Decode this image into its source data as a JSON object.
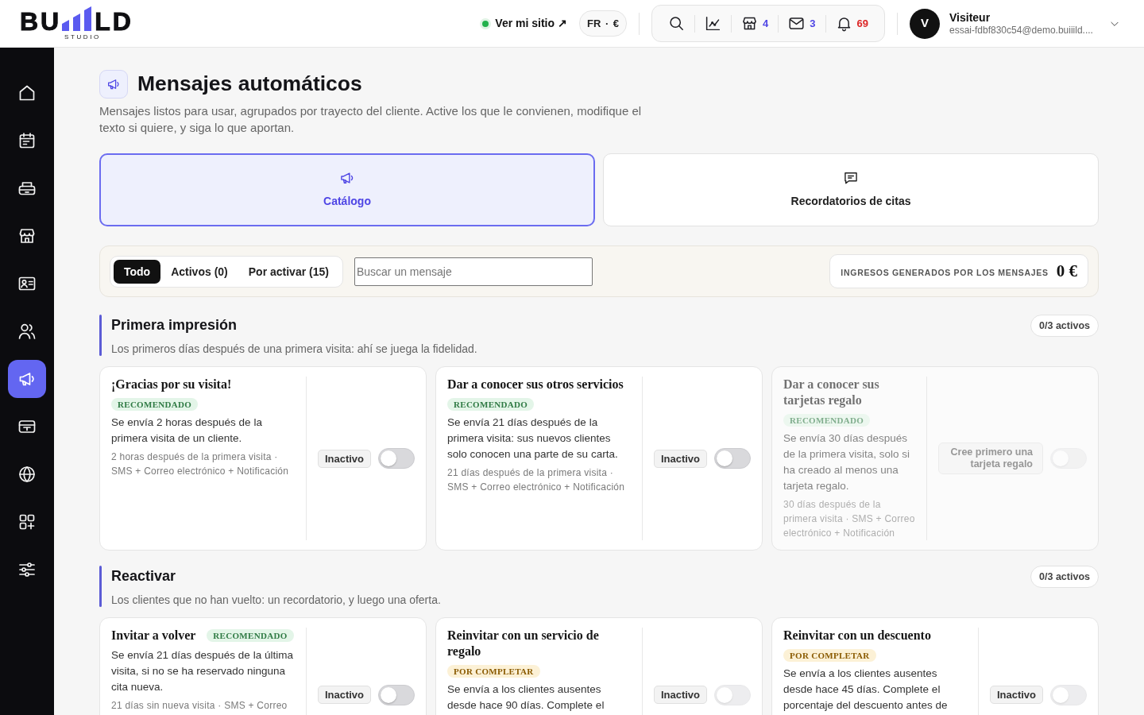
{
  "header": {
    "logo": {
      "left": "BU",
      "right": "LD",
      "tagline": "STUDIO"
    },
    "site_link": {
      "label": "Ver mi sitio ↗",
      "live": true
    },
    "locale": {
      "label": "FR · €"
    },
    "toolbar": [
      {
        "kind": "search"
      },
      {
        "kind": "chart"
      },
      {
        "kind": "store",
        "count": "4",
        "color": "#4f46e5"
      },
      {
        "kind": "mail",
        "count": "3",
        "color": "#4f46e5"
      },
      {
        "kind": "bell",
        "count": "69",
        "color": "#dc2626"
      }
    ],
    "user": {
      "initial": "V",
      "name": "Visiteur",
      "email": "essai-fdbf830c54@demo.buiiild...."
    }
  },
  "sidebar": {
    "items": [
      {
        "kind": "home",
        "selected": false
      },
      {
        "kind": "calendar",
        "selected": false
      },
      {
        "kind": "printer",
        "selected": false
      },
      {
        "kind": "store",
        "selected": false
      },
      {
        "kind": "contact",
        "selected": false
      },
      {
        "kind": "users",
        "selected": false
      },
      {
        "kind": "megaphone",
        "selected": true
      },
      {
        "kind": "card",
        "selected": false
      },
      {
        "kind": "globe",
        "selected": false
      },
      {
        "kind": "apps",
        "selected": false
      },
      {
        "kind": "sliders",
        "selected": false
      }
    ]
  },
  "page": {
    "title": "Mensajes automáticos",
    "description": "Mensajes listos para usar, agrupados por trayecto del cliente. Active los que le convienen, modifique el texto si quiere, y siga lo que aportan."
  },
  "category_tabs": [
    {
      "kind": "megaphone",
      "label": "Catálogo",
      "selected": true
    },
    {
      "kind": "chat",
      "label": "Recordatorios de citas",
      "selected": false
    }
  ],
  "filters": [
    {
      "label": "Todo",
      "selected": true
    },
    {
      "label": "Activos (0)",
      "selected": false
    },
    {
      "label": "Por activar (15)",
      "selected": false
    }
  ],
  "search": {
    "placeholder": "Buscar un mensaje"
  },
  "revenue": {
    "label": "INGRESOS GENERADOS POR LOS MENSAJES",
    "value": "0 €"
  },
  "sections": [
    {
      "title": "Primera impresión",
      "subtitle": "Los primeros días después de una primera visita: ahí se juega la fidelidad.",
      "active_count": "0/3 activos",
      "messages": [
        {
          "title": "¡Gracias por su visita!",
          "tag": {
            "kind": "recommended",
            "label": "RECOMENDADO"
          },
          "description": "Se envía 2 horas después de la primera visita de un cliente.",
          "meta": "2 horas después de la primera visita · SMS + Correo electrónico + Notificación",
          "status": "Inactivo",
          "on": false,
          "toggle_disabled": false,
          "disabled": false
        },
        {
          "title": "Dar a conocer sus otros servicios",
          "tag": {
            "kind": "recommended",
            "label": "RECOMENDADO"
          },
          "description": "Se envía 21 días después de la primera visita: sus nuevos clientes solo conocen una parte de su carta.",
          "meta": "21 días después de la primera visita · SMS + Correo electrónico + Notificación",
          "status": "Inactivo",
          "on": false,
          "toggle_disabled": false,
          "disabled": false
        },
        {
          "title": "Dar a conocer sus tarjetas regalo",
          "tag": {
            "kind": "recommended",
            "label": "RECOMENDADO"
          },
          "description": "Se envía 30 días después de la primera visita, solo si ha creado al menos una tarjeta regalo.",
          "meta": "30 días después de la primera visita · SMS + Correo electrónico + Notificación",
          "notice": "Cree primero una tarjeta regalo",
          "on": false,
          "toggle_disabled": true,
          "disabled": true
        }
      ]
    },
    {
      "title": "Reactivar",
      "subtitle": "Los clientes que no han vuelto: un recordatorio, y luego una oferta.",
      "active_count": "0/3 activos",
      "messages": [
        {
          "title": "Invitar a volver",
          "tag": {
            "kind": "recommended",
            "label": "RECOMENDADO"
          },
          "description": "Se envía 21 días después de la última visita, si no se ha reservado ninguna cita nueva.",
          "meta": "21 días sin nueva visita · SMS + Correo",
          "status": "Inactivo",
          "on": false,
          "toggle_disabled": false,
          "disabled": false
        },
        {
          "title": "Reinvitar con un servicio de regalo",
          "tag": {
            "kind": "incomplete",
            "label": "POR COMPLETAR"
          },
          "description": "Se envía a los clientes ausentes desde hace 90 días. Complete el",
          "status": "Inactivo",
          "on": false,
          "toggle_disabled": true,
          "disabled": false
        },
        {
          "title": "Reinvitar con un descuento",
          "tag": {
            "kind": "incomplete",
            "label": "POR COMPLETAR"
          },
          "description": "Se envía a los clientes ausentes desde hace 45 días. Complete el porcentaje del descuento antes de",
          "status": "Inactivo",
          "on": false,
          "toggle_disabled": true,
          "disabled": false
        }
      ]
    }
  ]
}
